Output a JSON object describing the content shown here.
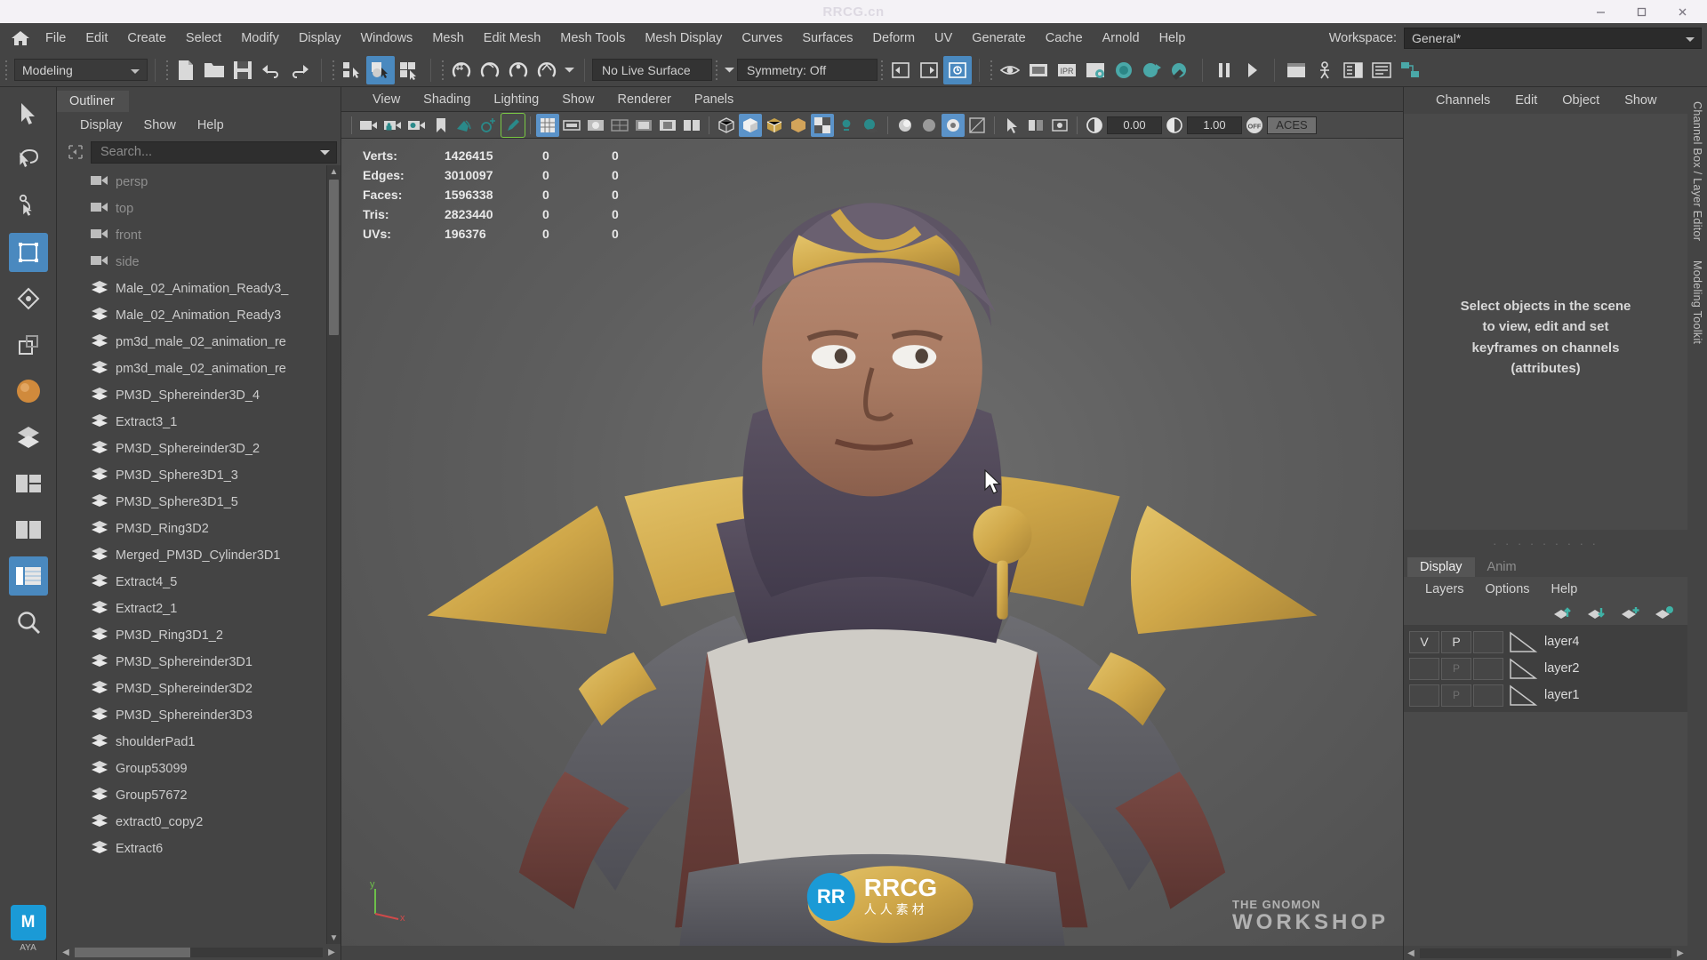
{
  "titlebar": {
    "watermark": "RRCG.cn",
    "minimize": "minimize-icon",
    "maximize": "maximize-icon",
    "close": "close-icon"
  },
  "menubar": {
    "home_icon": "home-icon",
    "items": [
      "File",
      "Edit",
      "Create",
      "Select",
      "Modify",
      "Display",
      "Windows",
      "Mesh",
      "Edit Mesh",
      "Mesh Tools",
      "Mesh Display",
      "Curves",
      "Surfaces",
      "Deform",
      "UV",
      "Generate",
      "Cache",
      "Arnold",
      "Help"
    ],
    "workspace_label": "Workspace:",
    "workspace_value": "General*"
  },
  "toolbar": {
    "menu_set": "Modeling",
    "live_surface": "No Live Surface",
    "symmetry": "Symmetry: Off",
    "icons": [
      "new-scene-icon",
      "open-scene-icon",
      "save-scene-icon",
      "undo-icon",
      "redo-icon",
      "select-hierarchy-icon",
      "select-object-icon",
      "select-component-icon",
      "snap-grid-icon",
      "snap-curve-icon",
      "snap-point-icon",
      "snap-projected-icon",
      "snap-view-icon",
      "render-current-frame-icon",
      "render-sequence-icon",
      "ipr-render-icon",
      "render-settings-icon",
      "hypershade-icon",
      "render-view-icon",
      "rendering-flags-icon",
      "pause-icon",
      "step-icon",
      "editor-icon",
      "build-icon",
      "outliner-icon",
      "list-icon",
      "node-editor-icon"
    ]
  },
  "rail": {
    "items": [
      {
        "name": "select-tool-icon",
        "selected": false
      },
      {
        "name": "lasso-tool-icon",
        "selected": false
      },
      {
        "name": "paint-select-tool-icon",
        "selected": false
      },
      {
        "name": "move-tool-icon",
        "selected": true
      },
      {
        "name": "rotate-tool-icon",
        "selected": false
      },
      {
        "name": "scale-tool-icon",
        "selected": false
      },
      {
        "name": "last-tool-icon",
        "selected": false
      },
      {
        "name": "shelf-grid-icon",
        "selected": false
      },
      {
        "name": "layout-two-pane-icon",
        "selected": false
      },
      {
        "name": "layout-three-pane-icon",
        "selected": false
      },
      {
        "name": "layout-outliner-icon",
        "selected": true
      },
      {
        "name": "search-icon",
        "selected": false
      }
    ],
    "bottom_badge": "M",
    "bottom_badge_sub": "AYA"
  },
  "outliner": {
    "tab_label": "Outliner",
    "menus": [
      "Display",
      "Show",
      "Help"
    ],
    "search_placeholder": "Search...",
    "filter_icon": "filter-icon",
    "items": [
      {
        "label": "persp",
        "type": "camera"
      },
      {
        "label": "top",
        "type": "camera"
      },
      {
        "label": "front",
        "type": "camera"
      },
      {
        "label": "side",
        "type": "camera"
      },
      {
        "label": "Male_02_Animation_Ready3_",
        "type": "mesh"
      },
      {
        "label": "Male_02_Animation_Ready3",
        "type": "mesh"
      },
      {
        "label": "pm3d_male_02_animation_re",
        "type": "mesh"
      },
      {
        "label": "pm3d_male_02_animation_re",
        "type": "mesh"
      },
      {
        "label": "PM3D_Sphereinder3D_4",
        "type": "mesh"
      },
      {
        "label": "Extract3_1",
        "type": "mesh"
      },
      {
        "label": "PM3D_Sphereinder3D_2",
        "type": "mesh"
      },
      {
        "label": "PM3D_Sphere3D1_3",
        "type": "mesh"
      },
      {
        "label": "PM3D_Sphere3D1_5",
        "type": "mesh"
      },
      {
        "label": "PM3D_Ring3D2",
        "type": "mesh"
      },
      {
        "label": "Merged_PM3D_Cylinder3D1",
        "type": "mesh"
      },
      {
        "label": "Extract4_5",
        "type": "mesh"
      },
      {
        "label": "Extract2_1",
        "type": "mesh"
      },
      {
        "label": "PM3D_Ring3D1_2",
        "type": "mesh"
      },
      {
        "label": "PM3D_Sphereinder3D1",
        "type": "mesh"
      },
      {
        "label": "PM3D_Sphereinder3D2",
        "type": "mesh"
      },
      {
        "label": "PM3D_Sphereinder3D3",
        "type": "mesh"
      },
      {
        "label": "shoulderPad1",
        "type": "mesh"
      },
      {
        "label": "Group53099",
        "type": "mesh"
      },
      {
        "label": "Group57672",
        "type": "mesh"
      },
      {
        "label": "extract0_copy2",
        "type": "mesh"
      },
      {
        "label": "Extract6",
        "type": "mesh"
      }
    ]
  },
  "viewport": {
    "menus": [
      "View",
      "Shading",
      "Lighting",
      "Show",
      "Renderer",
      "Panels"
    ],
    "exposure_value": "0.00",
    "gamma_value": "1.00",
    "off_toggle": "OFF",
    "color_space": "ACES",
    "hud": {
      "headers": [
        "",
        "",
        ""
      ],
      "rows": [
        {
          "label": "Verts:",
          "total": "1426415",
          "selected": "0",
          "other": "0"
        },
        {
          "label": "Edges:",
          "total": "3010097",
          "selected": "0",
          "other": "0"
        },
        {
          "label": "Faces:",
          "total": "1596338",
          "selected": "0",
          "other": "0"
        },
        {
          "label": "Tris:",
          "total": "2823440",
          "selected": "0",
          "other": "0"
        },
        {
          "label": "UVs:",
          "total": "196376",
          "selected": "0",
          "other": "0"
        }
      ]
    },
    "axis_y_label": "y",
    "axis_x_label": "x"
  },
  "rightpanel": {
    "tabs": [
      "Channels",
      "Edit",
      "Object",
      "Show"
    ],
    "channelbox_message_lines": [
      "Select objects in the scene",
      "to view, edit and set",
      "keyframes on channels",
      "(attributes)"
    ],
    "layer_tabs": [
      {
        "label": "Display",
        "active": true
      },
      {
        "label": "Anim",
        "active": false
      }
    ],
    "layer_menus": [
      "Layers",
      "Options",
      "Help"
    ],
    "layer_icon_names": [
      "move-layer-up-icon",
      "move-layer-down-icon",
      "new-layer-icon",
      "new-layer-from-selected-icon"
    ],
    "layers": [
      {
        "v": "V",
        "p": "P",
        "third": "",
        "name": "layer4",
        "v_on": true,
        "p_on": true
      },
      {
        "v": "",
        "p": "P",
        "third": "",
        "name": "layer2",
        "v_on": false,
        "p_on": false
      },
      {
        "v": "",
        "p": "P",
        "third": "",
        "name": "layer1",
        "v_on": false,
        "p_on": false
      }
    ]
  },
  "sidetabs": [
    "Channel Box / Layer Editor",
    "Modeling Toolkit"
  ],
  "branding": {
    "rrcg_letters": "RR",
    "rrcg_main": "RRCG",
    "rrcg_sub": "人人素材",
    "gnomon_line1": "THE GNOMON",
    "gnomon_line2": "GNOMON",
    "gnomon_line3": "WORKSHOP"
  },
  "colors": {
    "accent": "#4a89bf",
    "panel": "#444444",
    "viewport_bg": "#5e5e5e",
    "teal": "#4aa8a8"
  }
}
